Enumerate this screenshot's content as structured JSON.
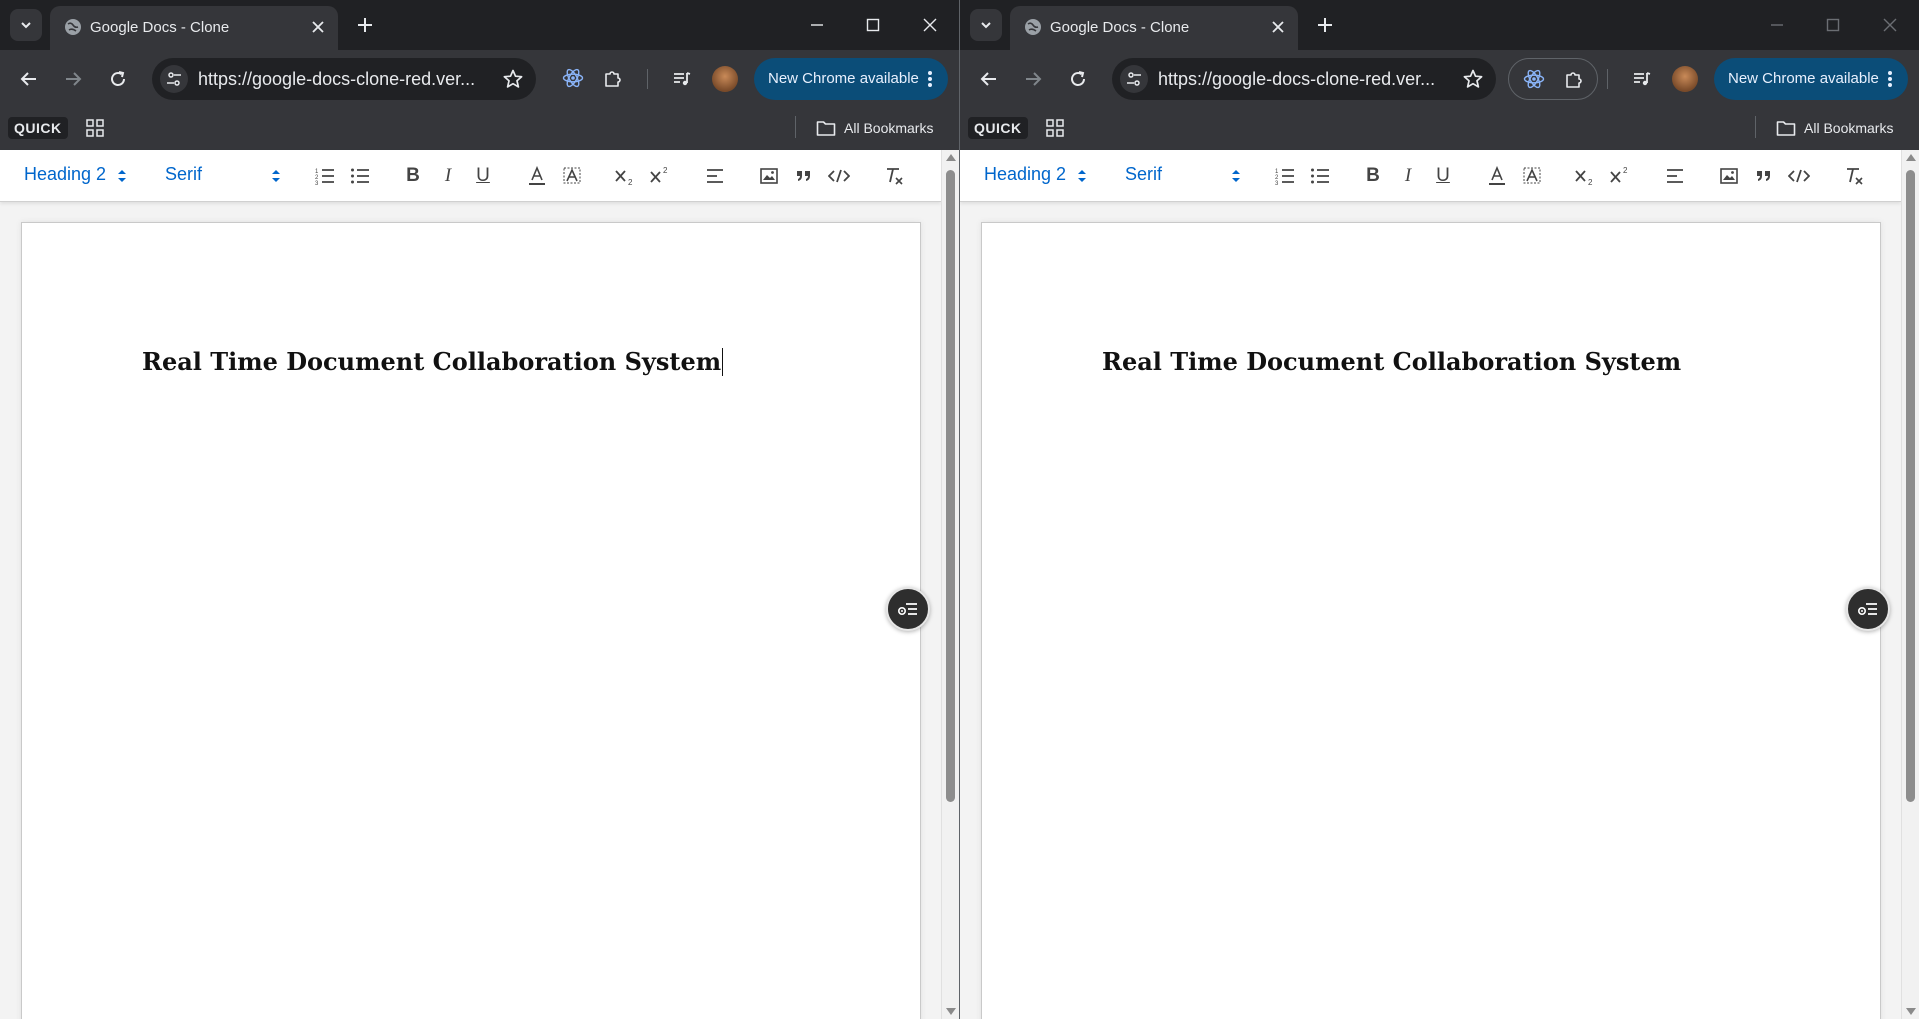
{
  "windows": [
    {
      "tab": {
        "title": "Google Docs - Clone",
        "favicon_icon": "globe-icon"
      },
      "omnibox": {
        "url": "https://google-docs-clone-red.ver..."
      },
      "update_button": {
        "label": "New Chrome available"
      },
      "bookmarks": {
        "quick": "QUICK",
        "all": "All Bookmarks"
      },
      "editor": {
        "heading_select": "Heading 2",
        "font_select": "Serif",
        "bold": "B",
        "italic": "I",
        "underline": "U"
      },
      "document": {
        "heading": "Real Time Document Collaboration System",
        "caret_visible": true
      }
    },
    {
      "tab": {
        "title": "Google Docs - Clone",
        "favicon_icon": "globe-icon"
      },
      "omnibox": {
        "url": "https://google-docs-clone-red.ver..."
      },
      "update_button": {
        "label": "New Chrome available"
      },
      "bookmarks": {
        "quick": "QUICK",
        "all": "All Bookmarks"
      },
      "editor": {
        "heading_select": "Heading 2",
        "font_select": "Serif",
        "bold": "B",
        "italic": "I",
        "underline": "U"
      },
      "document": {
        "heading": "Real Time Document Collaboration System",
        "caret_visible": false
      }
    }
  ],
  "colors": {
    "chrome_dark": "#202124",
    "chrome_toolbar": "#35363a",
    "update_button": "#0b4d78",
    "editor_select_blue": "#0066cc"
  }
}
